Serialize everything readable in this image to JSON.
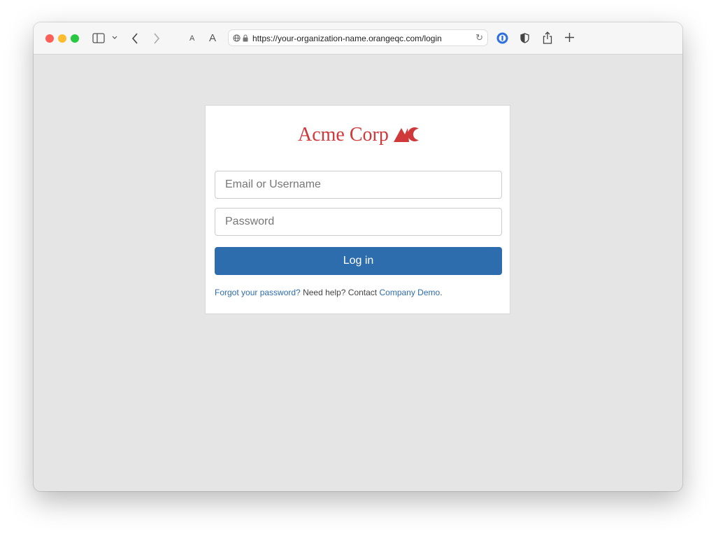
{
  "browser": {
    "url": "https://your-organization-name.orangeqc.com/login",
    "text_size_small": "A",
    "text_size_large": "A",
    "icons": [
      "close-dot",
      "minimize-dot",
      "zoom-dot",
      "sidebar-icon",
      "chevron-down-icon",
      "back-icon",
      "forward-icon",
      "globe-icon",
      "lock-icon",
      "reload-icon",
      "password-manager-icon",
      "shield-icon",
      "share-icon",
      "new-tab-icon"
    ]
  },
  "login": {
    "brand": "Acme Corp",
    "email_placeholder": "Email or Username",
    "password_placeholder": "Password",
    "submit_label": "Log in",
    "forgot_link": "Forgot your password?",
    "help_text": " Need help? Contact ",
    "contact_link": "Company Demo",
    "help_suffix": "."
  },
  "colors": {
    "brand": "#d0393a",
    "primary": "#2e6dad",
    "background": "#e5e5e5"
  }
}
